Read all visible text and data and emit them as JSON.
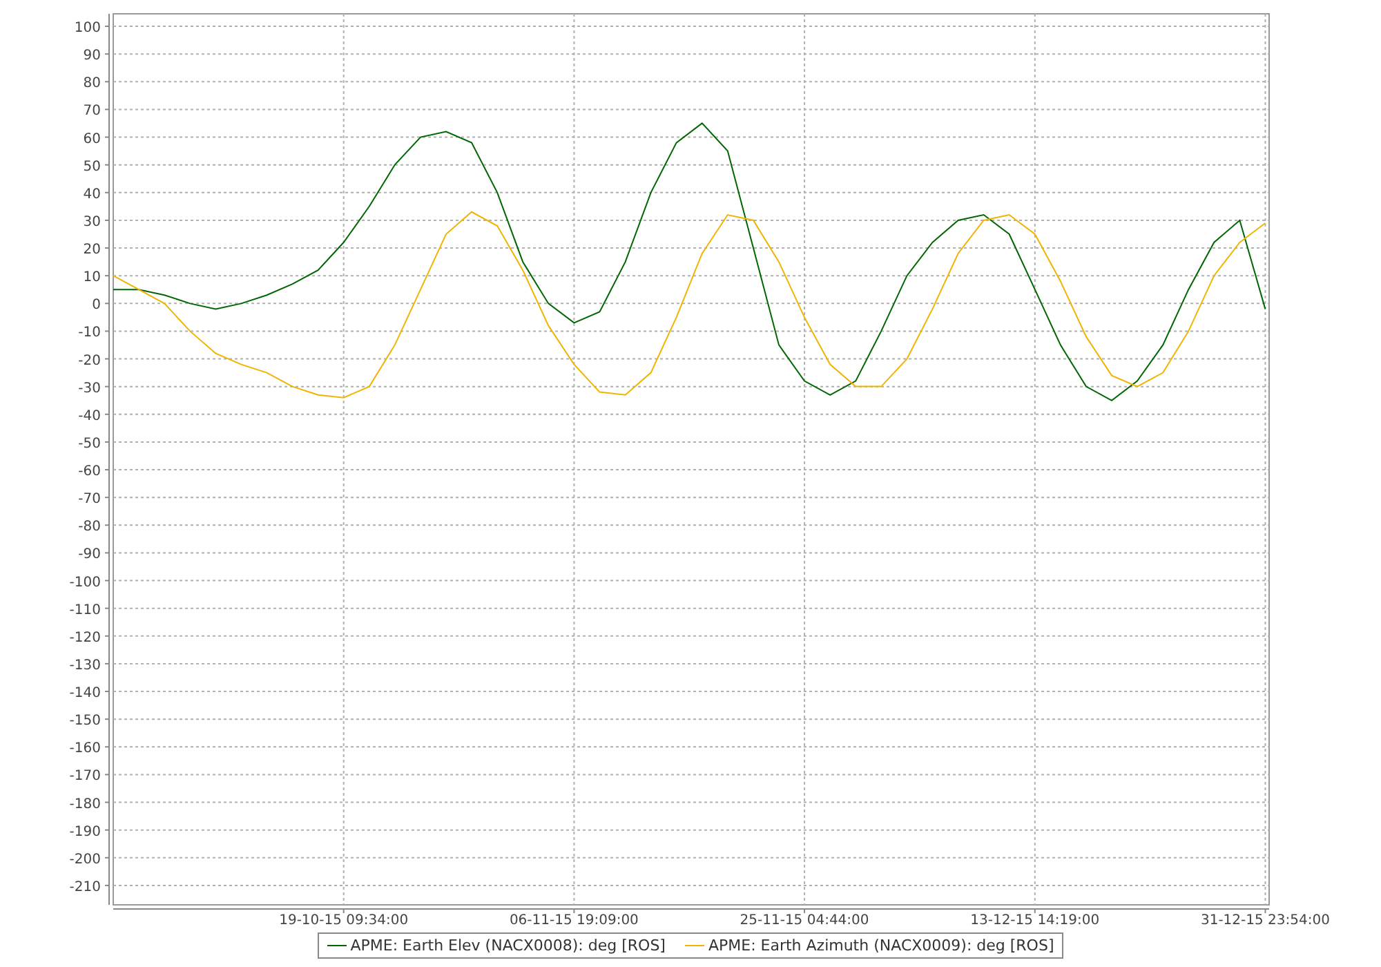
{
  "chart_data": {
    "type": "line",
    "grid": true,
    "categories": [
      null,
      null,
      null,
      null,
      null,
      null,
      null,
      null,
      null,
      "19-10-15 09:34:00",
      null,
      null,
      null,
      null,
      null,
      null,
      null,
      null,
      "06-11-15 19:09:00",
      null,
      null,
      null,
      null,
      null,
      null,
      null,
      null,
      "25-11-15 04:44:00",
      null,
      null,
      null,
      null,
      null,
      null,
      null,
      null,
      "13-12-15 14:19:00",
      null,
      null,
      null,
      null,
      null,
      null,
      null,
      null,
      "31-12-15 23:54:00"
    ],
    "series": [
      {
        "name": "APME: Earth Elev (NACX0008): deg [ROS]",
        "color": "#006600",
        "values": [
          5,
          5,
          3,
          0,
          -2,
          0,
          3,
          7,
          12,
          22,
          35,
          50,
          60,
          62,
          58,
          40,
          15,
          0,
          -7,
          -3,
          15,
          40,
          58,
          65,
          55,
          20,
          -15,
          -28,
          -33,
          -28,
          -10,
          10,
          22,
          30,
          32,
          25,
          5,
          -15,
          -30,
          -35,
          -28,
          -15,
          5,
          22,
          30,
          -2
        ]
      },
      {
        "name": "APME: Earth Azimuth (NACX0009): deg [ROS]",
        "color": "#f0b400",
        "values": [
          10,
          5,
          0,
          -10,
          -18,
          -22,
          -25,
          -30,
          -33,
          -34,
          -30,
          -15,
          5,
          25,
          33,
          28,
          12,
          -8,
          -22,
          -32,
          -33,
          -25,
          -5,
          18,
          32,
          30,
          15,
          -5,
          -22,
          -30,
          -30,
          -20,
          -2,
          18,
          30,
          32,
          25,
          8,
          -12,
          -26,
          -30,
          -25,
          -10,
          10,
          22,
          29
        ]
      }
    ],
    "ylim": [
      -217,
      104.5
    ],
    "yticks": [
      100,
      90,
      80,
      70,
      60,
      50,
      40,
      30,
      20,
      10,
      0,
      -10,
      -20,
      -30,
      -40,
      -50,
      -60,
      -70,
      -80,
      -90,
      -100,
      -110,
      -120,
      -130,
      -140,
      -150,
      -160,
      -170,
      -180,
      -190,
      -200,
      -210
    ]
  }
}
